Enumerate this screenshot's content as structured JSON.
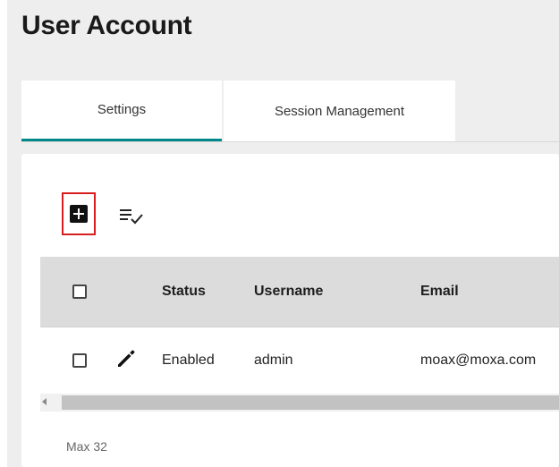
{
  "page": {
    "title": "User Account"
  },
  "tabs": [
    {
      "label": "Settings",
      "active": true
    },
    {
      "label": "Session Management",
      "active": false
    }
  ],
  "colors": {
    "active_tab_indicator": "#008787",
    "highlight_border": "#d81e1e",
    "table_header_bg": "#dcdcdc"
  },
  "toolbar": {
    "add_icon": "add-box-icon",
    "select_icon": "checklist-icon"
  },
  "table": {
    "columns": [
      "Status",
      "Username",
      "Email"
    ],
    "rows": [
      {
        "status": "Enabled",
        "username": "admin",
        "email": "moax@moxa.com"
      }
    ]
  },
  "footer": {
    "note": "Max 32"
  }
}
